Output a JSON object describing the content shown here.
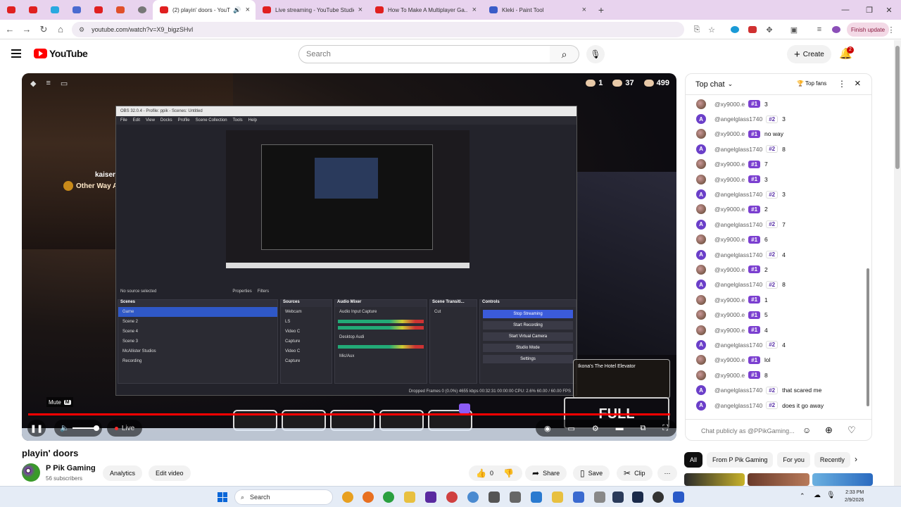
{
  "browser": {
    "tabs": [
      {
        "label": "(2) playin' doors - YouTube",
        "active": true,
        "audio": true
      },
      {
        "label": "Live streaming - YouTube Studio"
      },
      {
        "label": "How To Make A Multiplayer Ga..."
      },
      {
        "label": "Kleki - Paint Tool"
      }
    ],
    "new_tab": "+",
    "url": "youtube.com/watch?v=X9_bigzSHvI",
    "finish_update": "Finish update"
  },
  "header": {
    "logo": "YouTube",
    "search_placeholder": "Search",
    "create_label": "Create",
    "notification_count": "2"
  },
  "video": {
    "hud": {
      "a": "1",
      "b": "37",
      "c": "499"
    },
    "game_name": "kaiser_l",
    "game_text": "Other Way Ar",
    "obs_title": "OBS 32.0.4 - Profile: ppik - Scenes: Untitled",
    "obs_menu": [
      "File",
      "Edit",
      "View",
      "Docks",
      "Profile",
      "Scene Collection",
      "Tools",
      "Help"
    ],
    "obs_status": "No source selected",
    "obs_properties": "Properties",
    "obs_filters": "Filters",
    "docks": {
      "scenes": {
        "title": "Scenes",
        "items": [
          "Game",
          "Scene 2",
          "Scene 4",
          "Scene 3",
          "McAllister Studios",
          "Recording"
        ]
      },
      "sources": {
        "title": "Sources",
        "items": [
          "Webcam",
          "LS",
          "Video C",
          "Capture",
          "Video C",
          "Capture"
        ]
      },
      "mixer": {
        "title": "Audio Mixer",
        "items": [
          "Audio Input Capture",
          "Desktop Audi",
          "Mic/Aux"
        ]
      },
      "transitions": {
        "title": "Scene Transiti...",
        "items": [
          "Cut"
        ]
      },
      "controls": {
        "title": "Controls",
        "items": [
          "Stop Streaming",
          "Start Recording",
          "Start Virtual Camera",
          "Studio Mode",
          "Settings"
        ]
      }
    },
    "obs_bottom": "Dropped Frames 0 (0.0%)   4655 kbps   00:32:31   00:00:00   CPU: 2.6%   60.00 / 60.00 FPS",
    "elevator_text": "Ikona's The Hotel Elevator",
    "full_text": "FULL",
    "mute_tip": "Mute",
    "mute_key": "M",
    "live_label": "Live"
  },
  "below": {
    "title": "playin' doors",
    "channel": "P Pik Gaming",
    "subs": "56 subscribers",
    "analytics": "Analytics",
    "edit_video": "Edit video",
    "likes": "0",
    "share": "Share",
    "save": "Save",
    "clip": "Clip"
  },
  "chat": {
    "header": "Top chat",
    "top_fans": "Top fans",
    "input_placeholder": "Chat publicly as @PPikGaming...",
    "messages": [
      {
        "user": "@xy9000.e",
        "badge": "#1",
        "text": "3"
      },
      {
        "user": "@angelglass1740",
        "badge": "#2",
        "text": "3"
      },
      {
        "user": "@xy9000.e",
        "badge": "#1",
        "text": "no way"
      },
      {
        "user": "@angelglass1740",
        "badge": "#2",
        "text": "8"
      },
      {
        "user": "@xy9000.e",
        "badge": "#1",
        "text": "7"
      },
      {
        "user": "@xy9000.e",
        "badge": "#1",
        "text": "3"
      },
      {
        "user": "@angelglass1740",
        "badge": "#2",
        "text": "3"
      },
      {
        "user": "@xy9000.e",
        "badge": "#1",
        "text": "2"
      },
      {
        "user": "@angelglass1740",
        "badge": "#2",
        "text": "7"
      },
      {
        "user": "@xy9000.e",
        "badge": "#1",
        "text": "6"
      },
      {
        "user": "@angelglass1740",
        "badge": "#2",
        "text": "4"
      },
      {
        "user": "@xy9000.e",
        "badge": "#1",
        "text": "2"
      },
      {
        "user": "@angelglass1740",
        "badge": "#2",
        "text": "8"
      },
      {
        "user": "@xy9000.e",
        "badge": "#1",
        "text": "1"
      },
      {
        "user": "@xy9000.e",
        "badge": "#1",
        "text": "5"
      },
      {
        "user": "@xy9000.e",
        "badge": "#1",
        "text": "4"
      },
      {
        "user": "@angelglass1740",
        "badge": "#2",
        "text": "4"
      },
      {
        "user": "@xy9000.e",
        "badge": "#1",
        "text": "lol"
      },
      {
        "user": "@xy9000.e",
        "badge": "#1",
        "text": "8"
      },
      {
        "user": "@angelglass1740",
        "badge": "#2",
        "text": "that scared me"
      },
      {
        "user": "@angelglass1740",
        "badge": "#2",
        "text": "does it go away"
      }
    ]
  },
  "chips": [
    "All",
    "From P Pik Gaming",
    "For you",
    "Recently"
  ],
  "taskbar": {
    "search": "Search",
    "time": "2:33 PM",
    "date": "2/9/2026"
  },
  "colors": {
    "yt_red": "#ff0000",
    "badge_purple": "#7b3fd0",
    "obs_blue": "#3b5bdb"
  }
}
